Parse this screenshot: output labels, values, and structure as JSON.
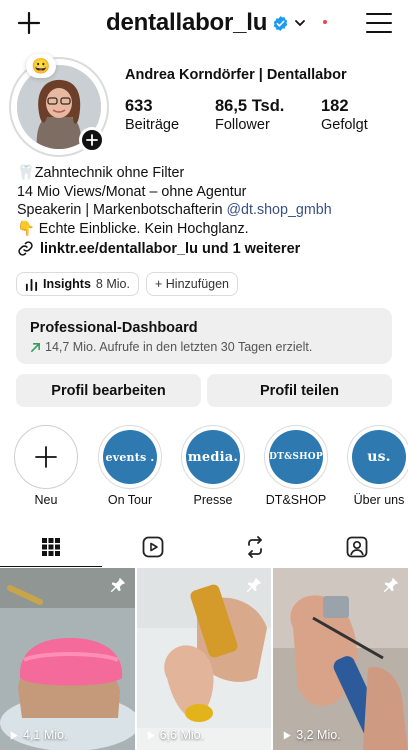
{
  "header": {
    "username": "dentallabor_lu",
    "verified_color": "#1d9bf0",
    "notification_dot_color": "#e5484d"
  },
  "profile": {
    "display_name": "Andrea Korndörfer | Dentallabor",
    "note_emoji": "😀",
    "stats": [
      {
        "value": "633",
        "label": "Beiträge"
      },
      {
        "value": "86,5 Tsd.",
        "label": "Follower"
      },
      {
        "value": "182",
        "label": "Gefolgt"
      }
    ]
  },
  "bio": {
    "line1": "🦷Zahntechnik ohne Filter",
    "line2": "14 Mio Views/Monat – ohne Agentur",
    "line3_text": "Speakerin | Markenbotschafterin ",
    "line3_mention": "@dt.shop_gmbh",
    "line4": "👇 Echte Einblicke. Kein Hochglanz.",
    "link": "linktr.ee/dentallabor_lu und 1 weiterer"
  },
  "pills": {
    "insights_label": "Insights",
    "insights_value": "8 Mio.",
    "add_label": "+ Hinzufügen"
  },
  "dashboard": {
    "title": "Professional-Dashboard",
    "subtitle": "14,7 Mio. Aufrufe in den letzten 30 Tagen erzielt.",
    "arrow_color": "#2e9e5b"
  },
  "actions": {
    "edit_label": "Profil bearbeiten",
    "share_label": "Profil teilen"
  },
  "highlights": [
    {
      "label": "Neu",
      "cover": ""
    },
    {
      "label": "On Tour",
      "cover": "events ."
    },
    {
      "label": "Presse",
      "cover": "media."
    },
    {
      "label": "DT&SHOP",
      "cover": "DT&SHOP"
    },
    {
      "label": "Über uns",
      "cover": "us."
    }
  ],
  "tabs": [
    "grid-icon",
    "reels-icon",
    "reposts-icon",
    "tagged-icon"
  ],
  "posts": [
    {
      "views": "4,1 Mio."
    },
    {
      "views": "6,6 Mio."
    },
    {
      "views": "3,2 Mio."
    }
  ]
}
